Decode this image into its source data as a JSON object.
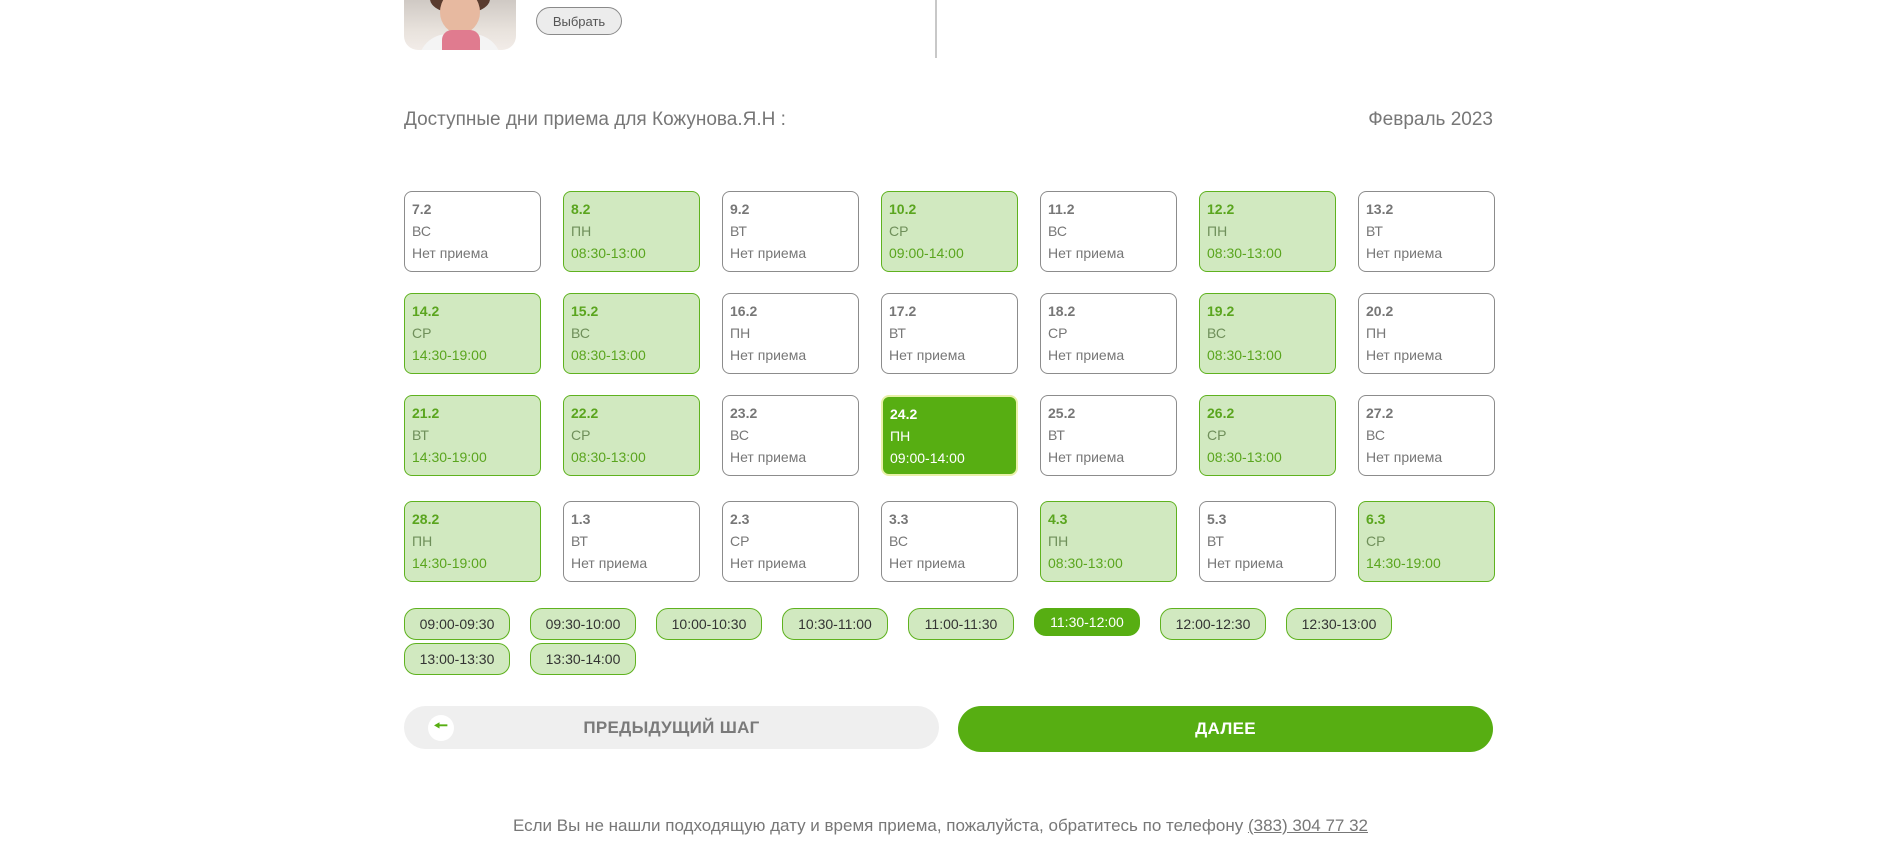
{
  "choose_button": "Выбрать",
  "heading": "Доступные дни приема для Кожунова.Я.Н :",
  "month": "Февраль 2023",
  "days": [
    {
      "date": "7.2",
      "weekday": "ВС",
      "status": "Нет приема",
      "state": "none"
    },
    {
      "date": "8.2",
      "weekday": "ПН",
      "status": "08:30-13:00",
      "state": "avail"
    },
    {
      "date": "9.2",
      "weekday": "ВТ",
      "status": "Нет приема",
      "state": "none"
    },
    {
      "date": "10.2",
      "weekday": "СР",
      "status": "09:00-14:00",
      "state": "avail"
    },
    {
      "date": "11.2",
      "weekday": "ВС",
      "status": "Нет приема",
      "state": "none"
    },
    {
      "date": "12.2",
      "weekday": "ПН",
      "status": "08:30-13:00",
      "state": "avail"
    },
    {
      "date": "13.2",
      "weekday": "ВТ",
      "status": "Нет приема",
      "state": "none"
    },
    {
      "date": "14.2",
      "weekday": "СР",
      "status": "14:30-19:00",
      "state": "avail"
    },
    {
      "date": "15.2",
      "weekday": "ВС",
      "status": "08:30-13:00",
      "state": "avail"
    },
    {
      "date": "16.2",
      "weekday": "ПН",
      "status": "Нет приема",
      "state": "none"
    },
    {
      "date": "17.2",
      "weekday": "ВТ",
      "status": "Нет приема",
      "state": "none"
    },
    {
      "date": "18.2",
      "weekday": "СР",
      "status": "Нет приема",
      "state": "none"
    },
    {
      "date": "19.2",
      "weekday": "ВС",
      "status": "08:30-13:00",
      "state": "avail"
    },
    {
      "date": "20.2",
      "weekday": "ПН",
      "status": "Нет приема",
      "state": "none"
    },
    {
      "date": "21.2",
      "weekday": "ВТ",
      "status": "14:30-19:00",
      "state": "avail"
    },
    {
      "date": "22.2",
      "weekday": "СР",
      "status": "08:30-13:00",
      "state": "avail"
    },
    {
      "date": "23.2",
      "weekday": "ВС",
      "status": "Нет приема",
      "state": "none"
    },
    {
      "date": "24.2",
      "weekday": "ПН",
      "status": "09:00-14:00",
      "state": "sel"
    },
    {
      "date": "25.2",
      "weekday": "ВТ",
      "status": "Нет приема",
      "state": "none"
    },
    {
      "date": "26.2",
      "weekday": "СР",
      "status": "08:30-13:00",
      "state": "avail"
    },
    {
      "date": "27.2",
      "weekday": "ВС",
      "status": "Нет приема",
      "state": "none"
    },
    {
      "date": "28.2",
      "weekday": "ПН",
      "status": "14:30-19:00",
      "state": "avail"
    },
    {
      "date": "1.3",
      "weekday": "ВТ",
      "status": "Нет приема",
      "state": "none"
    },
    {
      "date": "2.3",
      "weekday": "СР",
      "status": "Нет приема",
      "state": "none"
    },
    {
      "date": "3.3",
      "weekday": "ВС",
      "status": "Нет приема",
      "state": "none"
    },
    {
      "date": "4.3",
      "weekday": "ПН",
      "status": "08:30-13:00",
      "state": "avail"
    },
    {
      "date": "5.3",
      "weekday": "ВТ",
      "status": "Нет приема",
      "state": "none"
    },
    {
      "date": "6.3",
      "weekday": "СР",
      "status": "14:30-19:00",
      "state": "avail"
    }
  ],
  "slots": [
    {
      "label": "09:00-09:30",
      "selected": false
    },
    {
      "label": "09:30-10:00",
      "selected": false
    },
    {
      "label": "10:00-10:30",
      "selected": false
    },
    {
      "label": "10:30-11:00",
      "selected": false
    },
    {
      "label": "11:00-11:30",
      "selected": false
    },
    {
      "label": "11:30-12:00",
      "selected": true
    },
    {
      "label": "12:00-12:30",
      "selected": false
    },
    {
      "label": "12:30-13:00",
      "selected": false
    },
    {
      "label": "13:00-13:30",
      "selected": false
    },
    {
      "label": "13:30-14:00",
      "selected": false
    }
  ],
  "prev_button": "ПРЕДЫДУЩИЙ ШАГ",
  "prev_arrow": "🠔",
  "next_button": "ДАЛЕЕ",
  "footer_text": "Если Вы не нашли подходящую дату и время приема, пожалуйста, обратитесь по телефону",
  "footer_phone": "(383) 304 77 32"
}
